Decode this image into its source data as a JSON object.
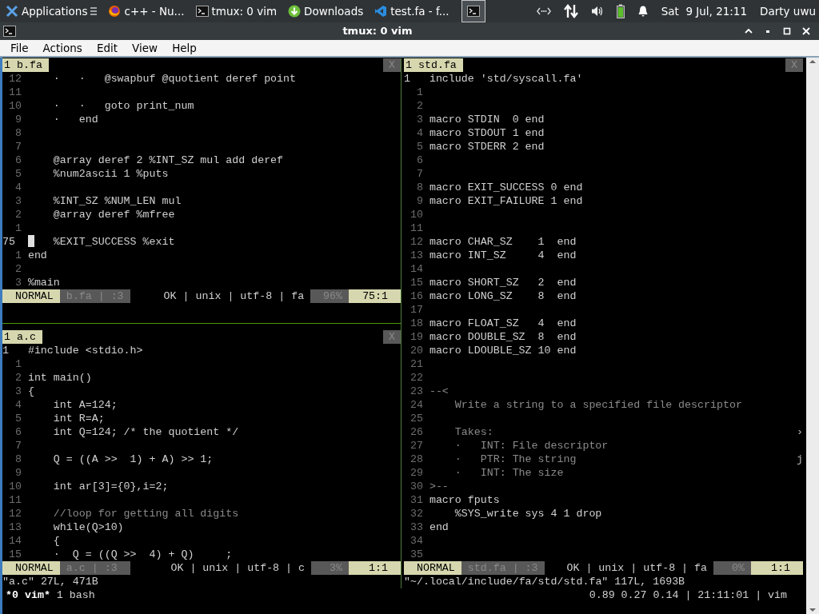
{
  "top_panel": {
    "items": [
      {
        "label": "Applications",
        "kind": "xfce",
        "selected": false
      },
      {
        "label": "c++ - Nu...",
        "kind": "browser",
        "selected": false
      },
      {
        "label": "tmux: 0 vim",
        "kind": "terminal",
        "selected": false
      },
      {
        "label": "Downloads",
        "kind": "download",
        "selected": false
      },
      {
        "label": "test.fa - f...",
        "kind": "editor",
        "selected": false
      },
      {
        "kind": "terminal",
        "selected": true
      }
    ],
    "clock": "Sat  9 Jul, 21:11",
    "user": "Darty uwu"
  },
  "window": {
    "title": "tmux: 0 vim"
  },
  "menu": [
    "File",
    "Actions",
    "Edit",
    "View",
    "Help"
  ],
  "panes": [
    {
      "tab": "1 b.fa",
      "close": "X",
      "lines": [
        {
          "num": "12",
          "text": "    ·   ·   @swapbuf @quotient deref point",
          "current": false
        },
        {
          "num": "11",
          "current": false
        },
        {
          "num": "10",
          "text": "    ·   ·   goto print_num",
          "current": false
        },
        {
          "num": "9",
          "text": "    ·   end",
          "current": false
        },
        {
          "num": "8",
          "current": false
        },
        {
          "num": "7",
          "current": false
        },
        {
          "num": "6",
          "text": "    @array deref 2 %INT_SZ mul add deref",
          "current": false
        },
        {
          "num": "5",
          "text": "    %num2ascii 1 %puts",
          "current": false
        },
        {
          "num": "4",
          "current": false
        },
        {
          "num": "3",
          "text": "    %INT_SZ %NUM_LEN mul",
          "current": false
        },
        {
          "num": "2",
          "text": "    @array deref %mfree",
          "current": false
        },
        {
          "num": "1",
          "current": false
        },
        {
          "num": "75",
          "text": "   %EXIT_SUCCESS %exit",
          "current": true,
          "cursor": true
        },
        {
          "num": "1",
          "text": "end",
          "current": false
        },
        {
          "num": "2",
          "current": false
        },
        {
          "num": "3",
          "text": "%main",
          "current": false
        }
      ],
      "status": {
        "mode": "NORMAL",
        "file": "b.fa | :3",
        "info": "OK | unix | utf-8 | fa",
        "percent": "96%",
        "position": "75:1"
      }
    },
    {
      "tab": "1 a.c",
      "close": "X",
      "lines": [
        {
          "num": "1",
          "text": "#include <stdio.h>",
          "current": true
        },
        {
          "num": "1",
          "current": false
        },
        {
          "num": "2",
          "text": "int main()",
          "current": false
        },
        {
          "num": "3",
          "text": "{",
          "current": false
        },
        {
          "num": "4",
          "text": "    int A=124;",
          "current": false
        },
        {
          "num": "5",
          "text": "    int R=A;",
          "current": false
        },
        {
          "num": "6",
          "text": "    int Q=124; /* the quotient */",
          "current": false
        },
        {
          "num": "7",
          "current": false
        },
        {
          "num": "8",
          "text": "    Q = ((A >>  1) + A) >> 1;",
          "current": false
        },
        {
          "num": "9",
          "current": false
        },
        {
          "num": "10",
          "text": "    int ar[3]={0},i=2;",
          "current": false
        },
        {
          "num": "11",
          "current": false
        },
        {
          "num": "12",
          "text": "    //loop for getting all digits",
          "current": false,
          "kind": "comment"
        },
        {
          "num": "13",
          "text": "    while(Q>10)",
          "current": false
        },
        {
          "num": "14",
          "text": "    {",
          "current": false
        },
        {
          "num": "15",
          "text": "    ·  Q = ((Q >>  4) + Q)     ;",
          "current": false
        }
      ],
      "status": {
        "mode": "NORMAL",
        "file": "a.c | :3",
        "info": "OK | unix | utf-8 | c",
        "percent": "3%",
        "position": "1:1"
      },
      "message": "\"a.c\" 27L, 471B"
    },
    {
      "tab": "1 std.fa",
      "close": "X",
      "lines": [
        {
          "num": "1",
          "text": "include 'std/syscall.fa'",
          "current": true
        },
        {
          "num": "1",
          "current": false
        },
        {
          "num": "2",
          "current": false
        },
        {
          "num": "3",
          "text": "macro STDIN  0 end",
          "current": false
        },
        {
          "num": "4",
          "text": "macro STDOUT 1 end",
          "current": false
        },
        {
          "num": "5",
          "text": "macro STDERR 2 end",
          "current": false
        },
        {
          "num": "6",
          "current": false
        },
        {
          "num": "7",
          "current": false
        },
        {
          "num": "8",
          "text": "macro EXIT_SUCCESS 0 end",
          "current": false
        },
        {
          "num": "9",
          "text": "macro EXIT_FAILURE 1 end",
          "current": false
        },
        {
          "num": "10",
          "current": false
        },
        {
          "num": "11",
          "current": false
        },
        {
          "num": "12",
          "text": "macro CHAR_SZ    1  end",
          "current": false
        },
        {
          "num": "13",
          "text": "macro INT_SZ     4  end",
          "current": false
        },
        {
          "num": "14",
          "current": false
        },
        {
          "num": "15",
          "text": "macro SHORT_SZ   2  end",
          "current": false
        },
        {
          "num": "16",
          "text": "macro LONG_SZ    8  end",
          "current": false
        },
        {
          "num": "17",
          "current": false
        },
        {
          "num": "18",
          "text": "macro FLOAT_SZ   4  end",
          "current": false
        },
        {
          "num": "19",
          "text": "macro DOUBLE_SZ  8  end",
          "current": false
        },
        {
          "num": "20",
          "text": "macro LDOUBLE_SZ 10 end",
          "current": false
        },
        {
          "num": "21",
          "current": false
        },
        {
          "num": "22",
          "current": false
        },
        {
          "num": "23",
          "text": "--<",
          "current": false,
          "kind": "comment"
        },
        {
          "num": "24",
          "text": "    Write a string to a specified file descriptor",
          "current": false,
          "kind": "comment"
        },
        {
          "num": "25",
          "current": false
        },
        {
          "num": "26",
          "text": "    Takes:",
          "current": false,
          "kind": "comment",
          "edge": "›"
        },
        {
          "num": "27",
          "text": "    ·   INT: File descriptor",
          "current": false,
          "kind": "comment"
        },
        {
          "num": "28",
          "text": "    ·   PTR: The string",
          "current": false,
          "kind": "comment",
          "edge": "j"
        },
        {
          "num": "29",
          "text": "    ·   INT: The size",
          "current": false,
          "kind": "comment"
        },
        {
          "num": "30",
          "text": ">--",
          "current": false,
          "kind": "comment"
        },
        {
          "num": "31",
          "text": "macro fputs",
          "current": false
        },
        {
          "num": "32",
          "text": "    %SYS_write sys 4 1 drop",
          "current": false
        },
        {
          "num": "33",
          "text": "end",
          "current": false
        },
        {
          "num": "34",
          "current": false
        },
        {
          "num": "35",
          "current": false
        }
      ],
      "status": {
        "mode": "NORMAL",
        "file": "std.fa | :3",
        "info": "OK | unix | utf-8 | fa",
        "percent": "0%",
        "position": "1:1"
      },
      "message": "\"~/.local/include/fa/std/std.fa\" 117L, 1693B"
    }
  ],
  "tmux": {
    "windows": [
      {
        "label": "*0 vim*",
        "selected": true
      },
      {
        "label": "1 bash",
        "selected": false
      }
    ],
    "right": "0.89 0.27 0.14 | 21:11:01 | vim"
  }
}
